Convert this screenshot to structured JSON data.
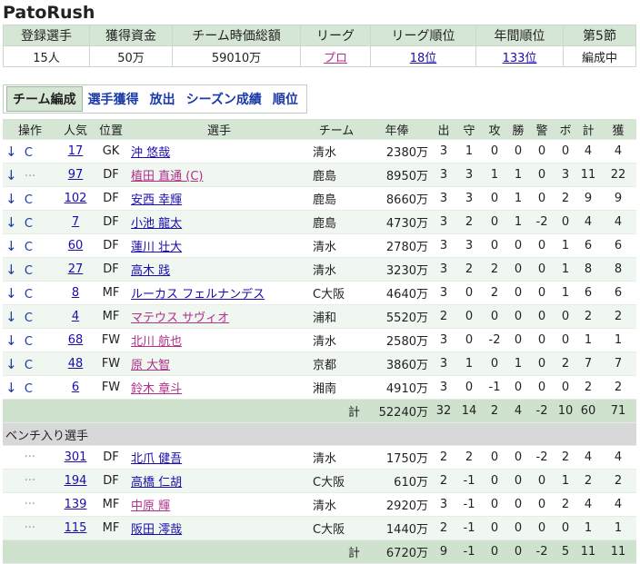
{
  "title": "PatoRush",
  "summary": {
    "headers": [
      "登録選手",
      "獲得資金",
      "チーム時価総額",
      "リーグ",
      "リーグ順位",
      "年間順位",
      "第5節"
    ],
    "values": {
      "players": "15人",
      "funds": "50万",
      "value": "59010万",
      "league": "プロ",
      "league_rank": "18位",
      "annual_rank": "133位",
      "status": "編成中"
    }
  },
  "tabs": [
    "チーム編成",
    "選手獲得",
    "放出",
    "シーズン成績",
    "順位"
  ],
  "columns": [
    "操作",
    "人気",
    "位置",
    "選手",
    "チーム",
    "年俸",
    "出",
    "守",
    "攻",
    "勝",
    "警",
    "ボ",
    "計",
    "獲"
  ],
  "starters": [
    {
      "arrow": "↓",
      "op": "C",
      "pop": "17",
      "pos": "GK",
      "name": "沖 悠哉",
      "team": "清水",
      "salary": "2380万",
      "s": [
        "3",
        "1",
        "0",
        "0",
        "0",
        "0",
        "4",
        "4"
      ]
    },
    {
      "arrow": "↓",
      "op": "···",
      "pop": "97",
      "pos": "DF",
      "name": "植田 直通 (C)",
      "team": "鹿島",
      "salary": "8950万",
      "s": [
        "3",
        "3",
        "1",
        "1",
        "0",
        "3",
        "11",
        "22"
      ]
    },
    {
      "arrow": "↓",
      "op": "C",
      "pop": "102",
      "pos": "DF",
      "name": "安西 幸輝",
      "team": "鹿島",
      "salary": "8660万",
      "s": [
        "3",
        "3",
        "0",
        "1",
        "0",
        "2",
        "9",
        "9"
      ]
    },
    {
      "arrow": "↓",
      "op": "C",
      "pop": "7",
      "pos": "DF",
      "name": "小池 龍太",
      "team": "鹿島",
      "salary": "4730万",
      "s": [
        "3",
        "2",
        "0",
        "1",
        "-2",
        "0",
        "4",
        "4"
      ]
    },
    {
      "arrow": "↓",
      "op": "C",
      "pop": "60",
      "pos": "DF",
      "name": "蓮川 壮大",
      "team": "清水",
      "salary": "2780万",
      "s": [
        "3",
        "3",
        "0",
        "0",
        "0",
        "1",
        "6",
        "6"
      ]
    },
    {
      "arrow": "↓",
      "op": "C",
      "pop": "27",
      "pos": "DF",
      "name": "高木 践",
      "team": "清水",
      "salary": "3230万",
      "s": [
        "3",
        "2",
        "2",
        "0",
        "0",
        "1",
        "8",
        "8"
      ]
    },
    {
      "arrow": "↓",
      "op": "C",
      "pop": "8",
      "pos": "MF",
      "name": "ルーカス フェルナンデス",
      "team": "C大阪",
      "salary": "4640万",
      "s": [
        "3",
        "0",
        "2",
        "0",
        "0",
        "1",
        "6",
        "6"
      ]
    },
    {
      "arrow": "↓",
      "op": "C",
      "pop": "4",
      "pos": "MF",
      "name": "マテウス サヴィオ",
      "team": "浦和",
      "salary": "5520万",
      "s": [
        "2",
        "0",
        "0",
        "0",
        "0",
        "0",
        "2",
        "2"
      ]
    },
    {
      "arrow": "↓",
      "op": "C",
      "pop": "68",
      "pos": "FW",
      "name": "北川 航也",
      "team": "清水",
      "salary": "2580万",
      "s": [
        "3",
        "0",
        "-2",
        "0",
        "0",
        "0",
        "1",
        "1"
      ]
    },
    {
      "arrow": "↓",
      "op": "C",
      "pop": "48",
      "pos": "FW",
      "name": "原 大智",
      "team": "京都",
      "salary": "3860万",
      "s": [
        "3",
        "1",
        "0",
        "1",
        "0",
        "2",
        "7",
        "7"
      ]
    },
    {
      "arrow": "↓",
      "op": "C",
      "pop": "6",
      "pos": "FW",
      "name": "鈴木 章斗",
      "team": "湘南",
      "salary": "4910万",
      "s": [
        "3",
        "0",
        "-1",
        "0",
        "0",
        "0",
        "2",
        "2"
      ]
    }
  ],
  "starters_total": {
    "label": "計",
    "salary": "52240万",
    "s": [
      "32",
      "14",
      "2",
      "4",
      "-2",
      "10",
      "60",
      "71"
    ]
  },
  "bench_title": "ベンチ入り選手",
  "bench": [
    {
      "op": "···",
      "pop": "301",
      "pos": "DF",
      "name": "北爪 健吾",
      "team": "清水",
      "salary": "1750万",
      "s": [
        "2",
        "2",
        "0",
        "0",
        "-2",
        "2",
        "4",
        "4"
      ]
    },
    {
      "op": "···",
      "pop": "194",
      "pos": "DF",
      "name": "高橋 仁胡",
      "team": "C大阪",
      "salary": "610万",
      "s": [
        "2",
        "-1",
        "0",
        "0",
        "0",
        "1",
        "2",
        "2"
      ]
    },
    {
      "op": "···",
      "pop": "139",
      "pos": "MF",
      "name": "中原 輝",
      "team": "清水",
      "salary": "2920万",
      "s": [
        "3",
        "-1",
        "0",
        "0",
        "0",
        "2",
        "4",
        "4"
      ]
    },
    {
      "op": "···",
      "pop": "115",
      "pos": "MF",
      "name": "阪田 澪哉",
      "team": "C大阪",
      "salary": "1440万",
      "s": [
        "2",
        "-1",
        "0",
        "0",
        "0",
        "0",
        "1",
        "1"
      ]
    }
  ],
  "bench_total": {
    "label": "計",
    "salary": "6720万",
    "s": [
      "9",
      "-1",
      "0",
      "0",
      "-2",
      "5",
      "11",
      "11"
    ]
  }
}
